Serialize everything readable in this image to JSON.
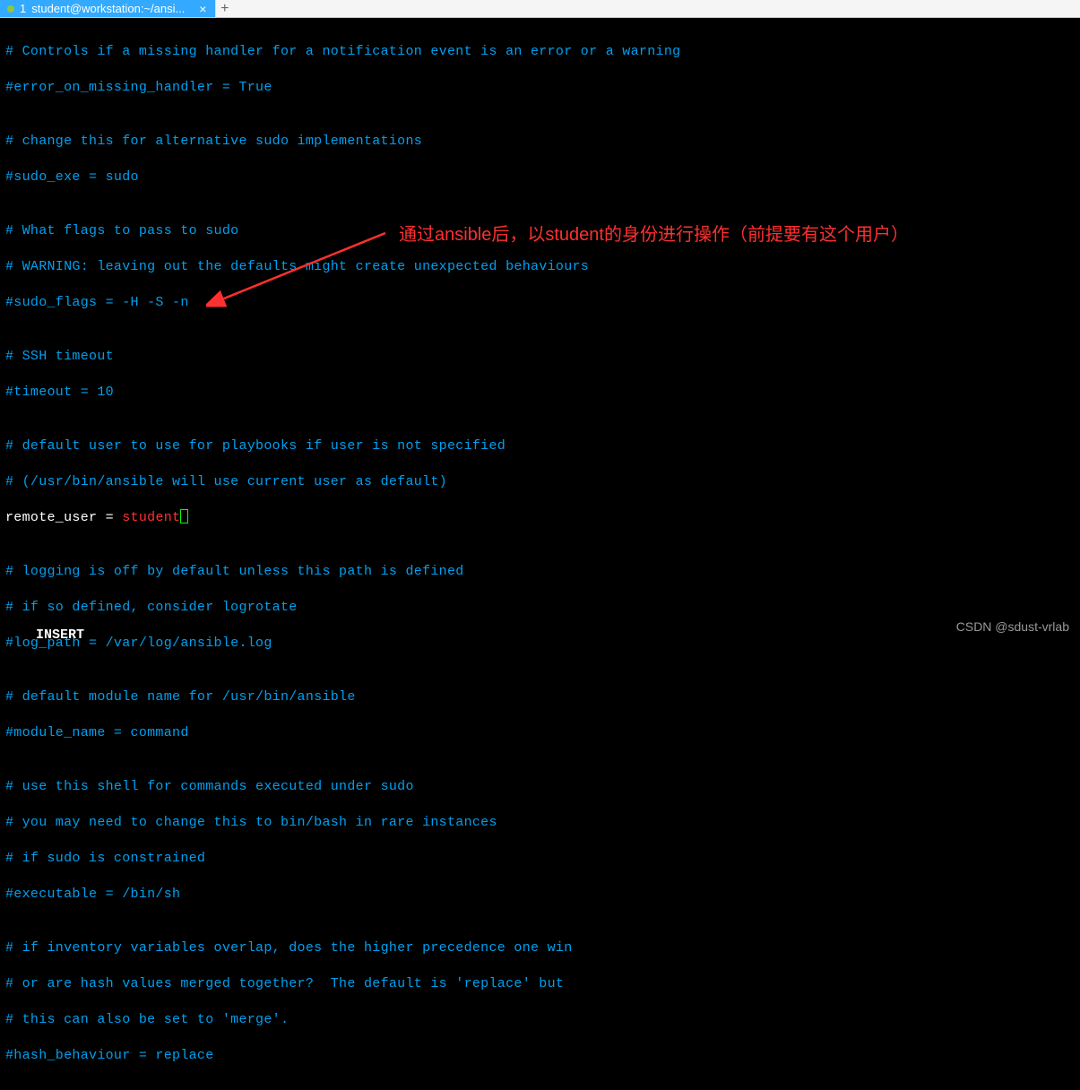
{
  "tab": {
    "number": "1",
    "title": "student@workstation:~/ansi...",
    "close": "×",
    "add": "+"
  },
  "lines": {
    "l1": "# Controls if a missing handler for a notification event is an error or a warning",
    "l2": "#error_on_missing_handler = True",
    "l3": "",
    "l4": "# change this for alternative sudo implementations",
    "l5": "#sudo_exe = sudo",
    "l6": "",
    "l7": "# What flags to pass to sudo",
    "l8": "# WARNING: leaving out the defaults might create unexpected behaviours",
    "l9": "#sudo_flags = -H -S -n",
    "l10": "",
    "l11": "# SSH timeout",
    "l12": "#timeout = 10",
    "l13": "",
    "l14": "# default user to use for playbooks if user is not specified",
    "l15": "# (/usr/bin/ansible will use current user as default)",
    "l16_key": "remote_user = ",
    "l16_value": "student",
    "l17": "",
    "l18": "# logging is off by default unless this path is defined",
    "l19": "# if so defined, consider logrotate",
    "l20": "#log_path = /var/log/ansible.log",
    "l21": "",
    "l22": "# default module name for /usr/bin/ansible",
    "l23": "#module_name = command",
    "l24": "",
    "l25": "# use this shell for commands executed under sudo",
    "l26": "# you may need to change this to bin/bash in rare instances",
    "l27": "# if sudo is constrained",
    "l28": "#executable = /bin/sh",
    "l29": "",
    "l30": "# if inventory variables overlap, does the higher precedence one win",
    "l31": "# or are hash values merged together?  The default is 'replace' but",
    "l32": "# this can also be set to 'merge'.",
    "l33": "#hash_behaviour = replace"
  },
  "annotation": "通过ansible后，以student的身份进行操作（前提要有这个用户）",
  "mode": "INSERT",
  "watermark": "CSDN @sdust-vrlab"
}
